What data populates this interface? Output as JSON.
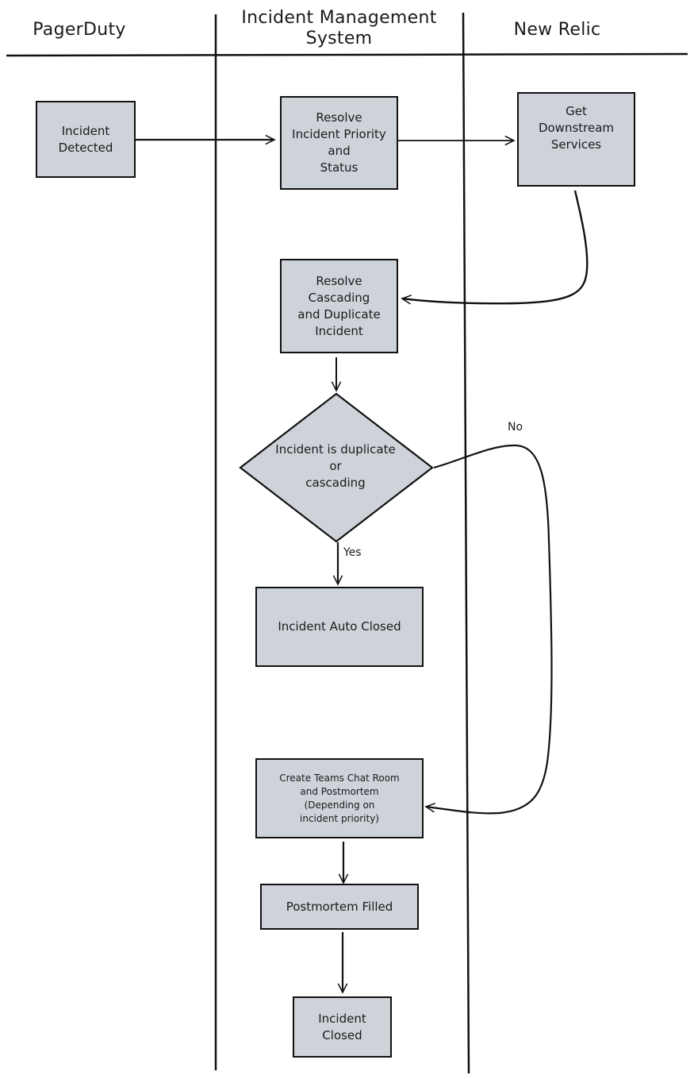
{
  "diagram": {
    "type": "swimlane-flowchart",
    "style": "hand-drawn",
    "colors": {
      "node_fill": "#ced3da",
      "stroke": "#111111",
      "background": "#ffffff"
    },
    "lanes": [
      {
        "id": "pagerduty",
        "title": "PagerDuty"
      },
      {
        "id": "ims",
        "title": "Incident Management\nSystem"
      },
      {
        "id": "newrelic",
        "title": "New Relic"
      }
    ],
    "nodes": {
      "incident_detected": {
        "lane": "pagerduty",
        "shape": "rectangle",
        "label": "Incident\nDetected"
      },
      "resolve_priority": {
        "lane": "ims",
        "shape": "rectangle",
        "label": "Resolve\nIncident Priority\nand\nStatus"
      },
      "get_downstream": {
        "lane": "newrelic",
        "shape": "rectangle",
        "label": "Get\nDownstream\nServices"
      },
      "resolve_cascading": {
        "lane": "ims",
        "shape": "rectangle",
        "label": "Resolve\nCascading\nand Duplicate\nIncident"
      },
      "is_duplicate": {
        "lane": "ims",
        "shape": "diamond",
        "label": "Incident is duplicate\nor\ncascading"
      },
      "auto_closed": {
        "lane": "ims",
        "shape": "rectangle",
        "label": "Incident Auto Closed"
      },
      "create_teams": {
        "lane": "ims",
        "shape": "rectangle",
        "label": "Create Teams Chat Room\nand Postmortem\n(Depending on\nincident priority)"
      },
      "postmortem_filled": {
        "lane": "ims",
        "shape": "rectangle",
        "label": "Postmortem Filled"
      },
      "incident_closed": {
        "lane": "ims",
        "shape": "rectangle",
        "label": "Incident\nClosed"
      }
    },
    "edges": [
      {
        "from": "incident_detected",
        "to": "resolve_priority",
        "label": ""
      },
      {
        "from": "resolve_priority",
        "to": "get_downstream",
        "label": ""
      },
      {
        "from": "get_downstream",
        "to": "resolve_cascading",
        "label": ""
      },
      {
        "from": "resolve_cascading",
        "to": "is_duplicate",
        "label": ""
      },
      {
        "from": "is_duplicate",
        "to": "auto_closed",
        "label": "Yes"
      },
      {
        "from": "is_duplicate",
        "to": "create_teams",
        "label": "No"
      },
      {
        "from": "create_teams",
        "to": "postmortem_filled",
        "label": ""
      },
      {
        "from": "postmortem_filled",
        "to": "incident_closed",
        "label": ""
      }
    ]
  }
}
